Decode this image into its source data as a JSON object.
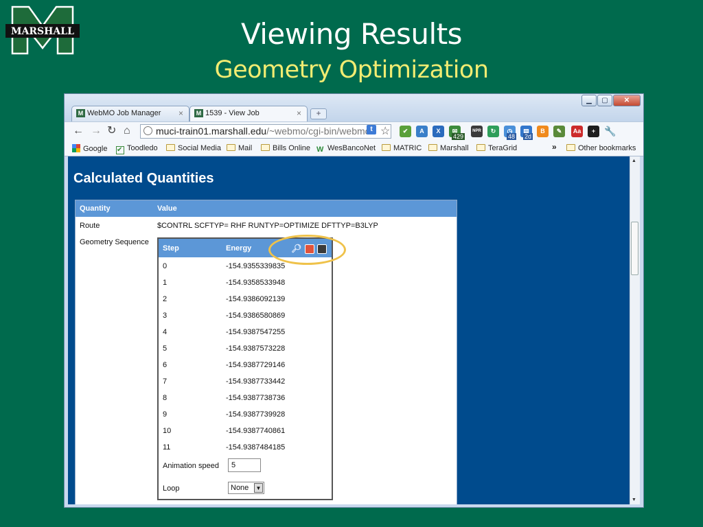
{
  "slide": {
    "logo_text": "MARSHALL",
    "title": "Viewing Results",
    "subtitle": "Geometry Optimization"
  },
  "browser": {
    "tabs": [
      {
        "label": "WebMO Job Manager",
        "active": false
      },
      {
        "label": "1539 - View Job",
        "active": true
      }
    ],
    "url_host": "muci-train01.marshall.edu",
    "url_path": "/~webmo/cgi-bin/webmo",
    "extension_counts": [
      "429",
      "48",
      "2d"
    ],
    "bookmarks": [
      {
        "label": "Google",
        "icon": "google-icon"
      },
      {
        "label": "Toodledo",
        "icon": "checkbox-icon"
      },
      {
        "label": "Social Media",
        "icon": "folder-icon"
      },
      {
        "label": "Mail",
        "icon": "folder-icon"
      },
      {
        "label": "Bills Online",
        "icon": "folder-icon"
      },
      {
        "label": "WesBancoNet",
        "icon": "wesbanco-icon"
      },
      {
        "label": "MATRIC",
        "icon": "folder-icon"
      },
      {
        "label": "Marshall",
        "icon": "folder-icon"
      },
      {
        "label": "TeraGrid",
        "icon": "folder-icon"
      }
    ],
    "overflow": "»",
    "other_bookmarks": "Other bookmarks"
  },
  "page": {
    "heading": "Calculated Quantities",
    "table_headers": {
      "quantity": "Quantity",
      "value": "Value"
    },
    "route_label": "Route",
    "route_value": "$CONTRL SCFTYP= RHF RUNTYP=OPTIMIZE DFTTYP=B3LYP",
    "geometry_label": "Geometry Sequence",
    "sequence": {
      "headers": {
        "step": "Step",
        "energy": "Energy"
      },
      "rows": [
        {
          "step": "0",
          "energy": "-154.9355339835"
        },
        {
          "step": "1",
          "energy": "-154.9358533948"
        },
        {
          "step": "2",
          "energy": "-154.9386092139"
        },
        {
          "step": "3",
          "energy": "-154.9386580869"
        },
        {
          "step": "4",
          "energy": "-154.9387547255"
        },
        {
          "step": "5",
          "energy": "-154.9387573228"
        },
        {
          "step": "6",
          "energy": "-154.9387729146"
        },
        {
          "step": "7",
          "energy": "-154.9387733442"
        },
        {
          "step": "8",
          "energy": "-154.9387738736"
        },
        {
          "step": "9",
          "energy": "-154.9387739928"
        },
        {
          "step": "10",
          "energy": "-154.9387740861"
        },
        {
          "step": "11",
          "energy": "-154.9387484185"
        }
      ],
      "animation_speed_label": "Animation speed",
      "animation_speed_value": "5",
      "loop_label": "Loop",
      "loop_value": "None"
    }
  },
  "colors": {
    "slide_bg": "#006a4d",
    "subtitle": "#f2ec72",
    "page_bg": "#004b8d",
    "header_blue": "#5c97d7",
    "highlight": "#efc24a"
  }
}
